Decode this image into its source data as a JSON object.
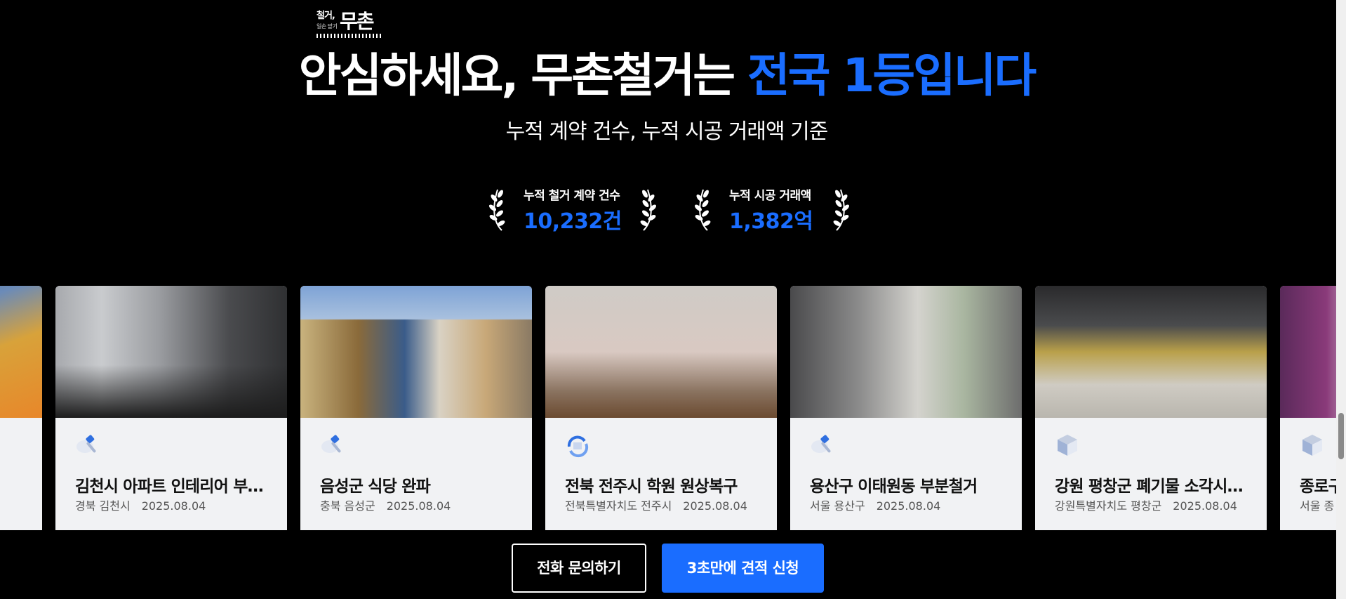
{
  "logo": {
    "line1": "철거,",
    "line2": "일손 맡기",
    "main": "무촌"
  },
  "headline": {
    "part1": "안심하세요, 무촌철거는 ",
    "accent": "전국 1등입니다"
  },
  "subhead": "누적 계약 건수, 누적 시공 거래액 기준",
  "stats": [
    {
      "label": "누적 철거 계약 건수",
      "value": "10,232",
      "unit": "건"
    },
    {
      "label": "누적 시공 거래액",
      "value": "1,382",
      "unit": "억"
    }
  ],
  "cards": [
    {
      "title": "…",
      "region": "",
      "date": "",
      "icon": "hammer-icon"
    },
    {
      "title": "김천시 아파트 인테리어 부분철거",
      "region": "경북 김천시",
      "date": "2025.08.04",
      "icon": "hammer-icon"
    },
    {
      "title": "음성군 식당 완파",
      "region": "충북 음성군",
      "date": "2025.08.04",
      "icon": "hammer-icon"
    },
    {
      "title": "전북 전주시 학원 원상복구",
      "region": "전북특별자치도 전주시",
      "date": "2025.08.04",
      "icon": "restore-icon"
    },
    {
      "title": "용산구 이태원동 부분철거",
      "region": "서울 용산구",
      "date": "2025.08.04",
      "icon": "hammer-icon"
    },
    {
      "title": "강원 평창군 폐기물 소각시설 철거",
      "region": "강원특별자치도 평창군",
      "date": "2025.08.04",
      "icon": "cube-icon"
    },
    {
      "title": "종로구",
      "region": "서울 종",
      "date": "",
      "icon": "cube-icon"
    }
  ],
  "buttons": {
    "call": "전화 문의하기",
    "quote": "3초만에 견적 신청"
  },
  "colors": {
    "accent": "#1a6dff",
    "background": "#000000",
    "card": "#f1f2f4"
  }
}
